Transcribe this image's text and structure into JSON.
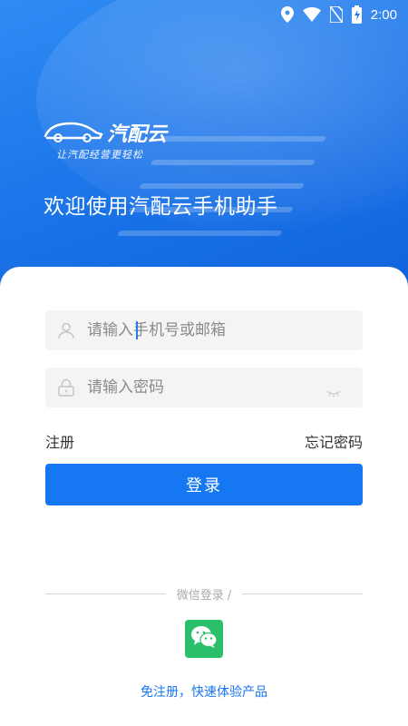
{
  "status_bar": {
    "time": "2:00",
    "icons": [
      "location-icon",
      "wifi-icon",
      "sim-no-signal-icon",
      "battery-charging-icon"
    ]
  },
  "header": {
    "brand": "汽配云",
    "slogan": "让汽配经营更轻松",
    "welcome": "欢迎使用汽配云手机助手"
  },
  "login_form": {
    "account_placeholder": "请输入手机号或邮箱",
    "password_placeholder": "请输入密码",
    "register_label": "注册",
    "forgot_label": "忘记密码",
    "login_label": "登录"
  },
  "wechat": {
    "divider_label": "微信登录 /",
    "trial_label": "免注册，快速体验产品"
  },
  "colors": {
    "primary": "#1677f2",
    "wechat_green": "#2bbf6b",
    "field_bg": "#f3f4f6"
  }
}
